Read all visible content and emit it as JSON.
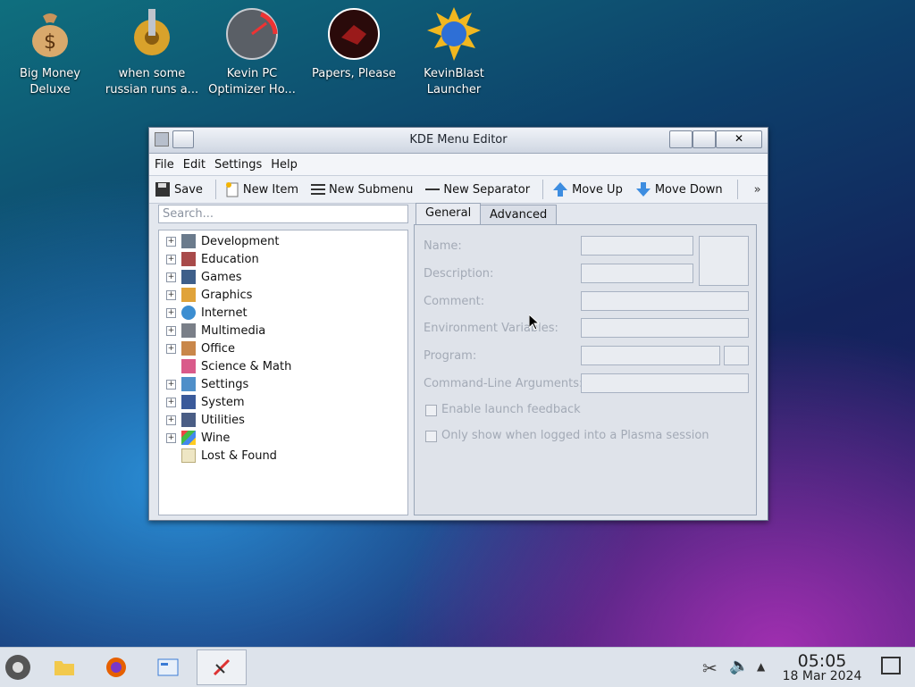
{
  "desktop": {
    "icons": [
      {
        "label": "Big Money\nDeluxe",
        "line1": "Big Money",
        "line2": "Deluxe"
      },
      {
        "line1": "when some",
        "line2": "russian runs a..."
      },
      {
        "line1": "Kevin PC",
        "line2": "Optimizer Ho..."
      },
      {
        "line1": "Papers, Please",
        "line2": ""
      },
      {
        "line1": "KevinBlast",
        "line2": "Launcher"
      }
    ]
  },
  "window": {
    "title": "KDE Menu Editor",
    "menu": [
      "File",
      "Edit",
      "Settings",
      "Help"
    ],
    "toolbar": {
      "save": "Save",
      "new_item": "New Item",
      "new_submenu": "New Submenu",
      "new_separator": "New Separator",
      "move_up": "Move Up",
      "move_down": "Move Down",
      "overflow": "»"
    },
    "search": {
      "placeholder": "Search..."
    },
    "tree": [
      "Development",
      "Education",
      "Games",
      "Graphics",
      "Internet",
      "Multimedia",
      "Office",
      "Science & Math",
      "Settings",
      "System",
      "Utilities",
      "Wine",
      "Lost & Found"
    ],
    "tabs": {
      "general": "General",
      "advanced": "Advanced"
    },
    "form": {
      "name": "Name:",
      "description": "Description:",
      "comment": "Comment:",
      "env": "Environment Variables:",
      "program": "Program:",
      "args": "Command-Line Arguments:",
      "launch_feedback": "Enable launch feedback",
      "plasma_only": "Only show when logged into a Plasma session"
    }
  },
  "taskbar": {
    "time": "05:05",
    "date": "18 Mar 2024"
  }
}
